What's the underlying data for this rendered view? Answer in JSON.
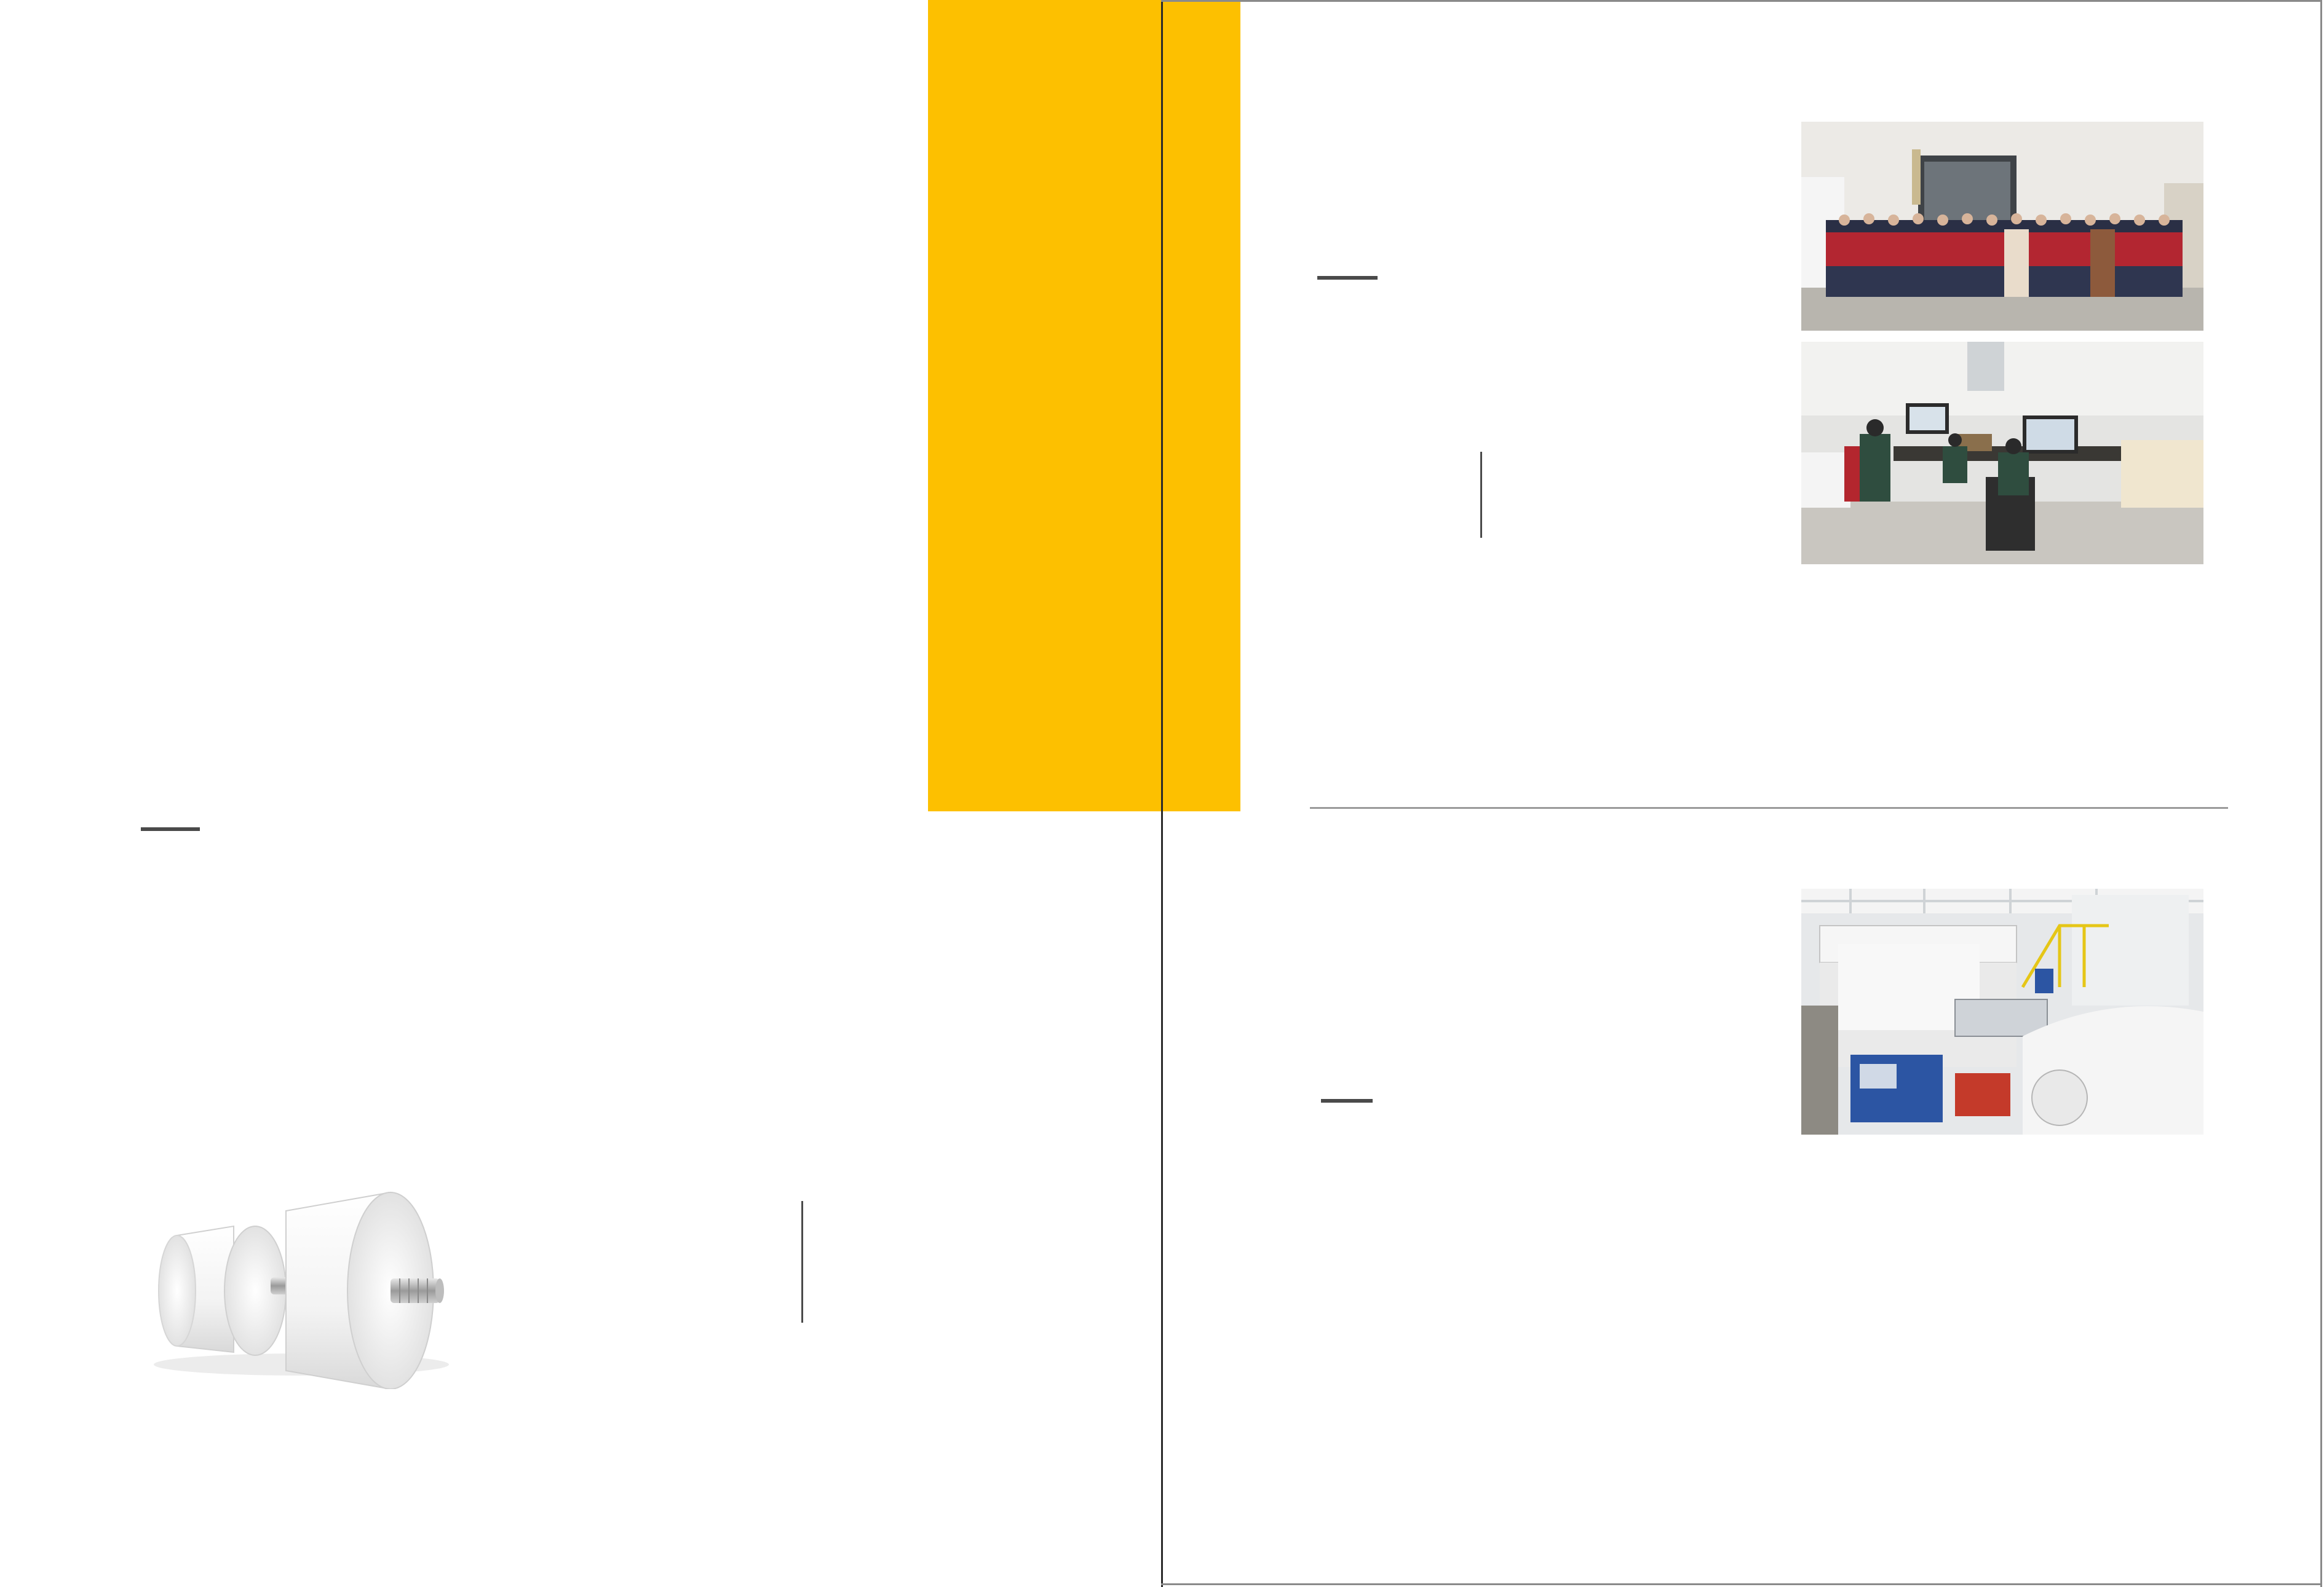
{
  "colors": {
    "accent_yellow": "#FDC000",
    "rule_dark": "#4A4A4A",
    "frame_gray": "#8A8A8A"
  },
  "images": {
    "team_photo": "group-of-employees-in-front-of-factory",
    "office_photo": "office-workers-at-computers",
    "machine_photo": "coating-production-machine",
    "product_render": "paper-rolls-on-spindle"
  }
}
